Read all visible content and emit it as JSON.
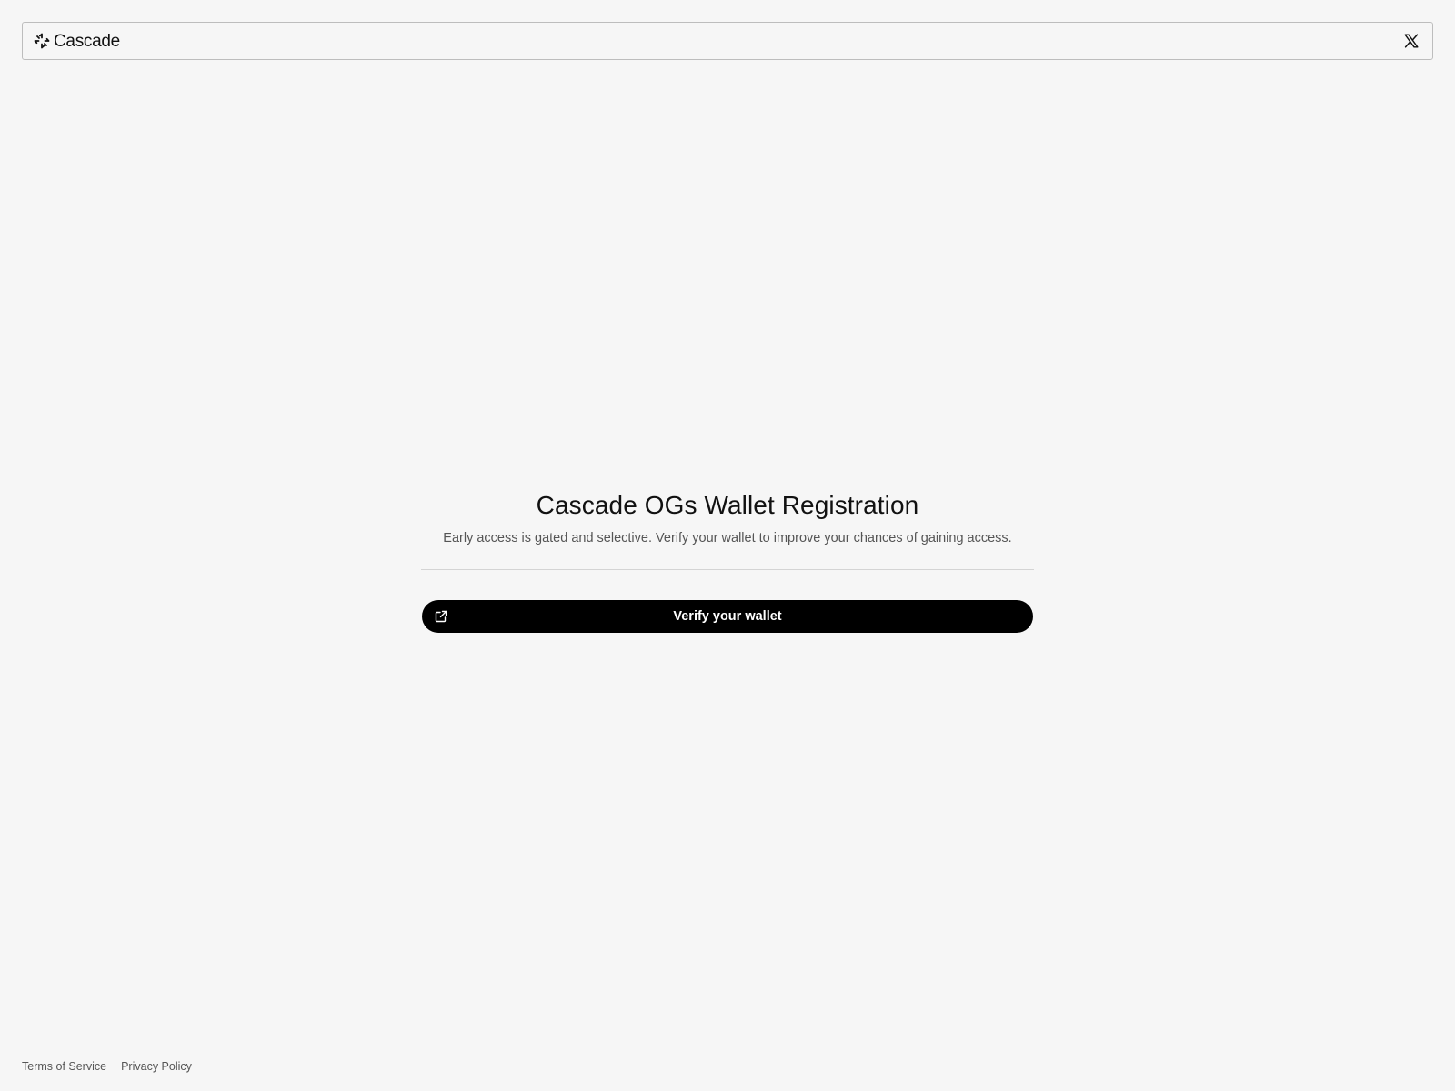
{
  "header": {
    "brand_name": "Cascade",
    "logo_icon": "cascade-logo-icon",
    "social_icon": "x-icon"
  },
  "main": {
    "title": "Cascade OGs Wallet Registration",
    "subtitle": "Early access is gated and selective. Verify your wallet to improve your chances of gaining access.",
    "verify_button_label": "Verify your wallet",
    "verify_button_icon": "external-link-icon"
  },
  "footer": {
    "links": [
      {
        "label": "Terms of Service"
      },
      {
        "label": "Privacy Policy"
      }
    ]
  },
  "colors": {
    "background": "#f6f6f6",
    "button": "#000000",
    "button_text": "#ffffff",
    "border": "#bdbdbd"
  }
}
